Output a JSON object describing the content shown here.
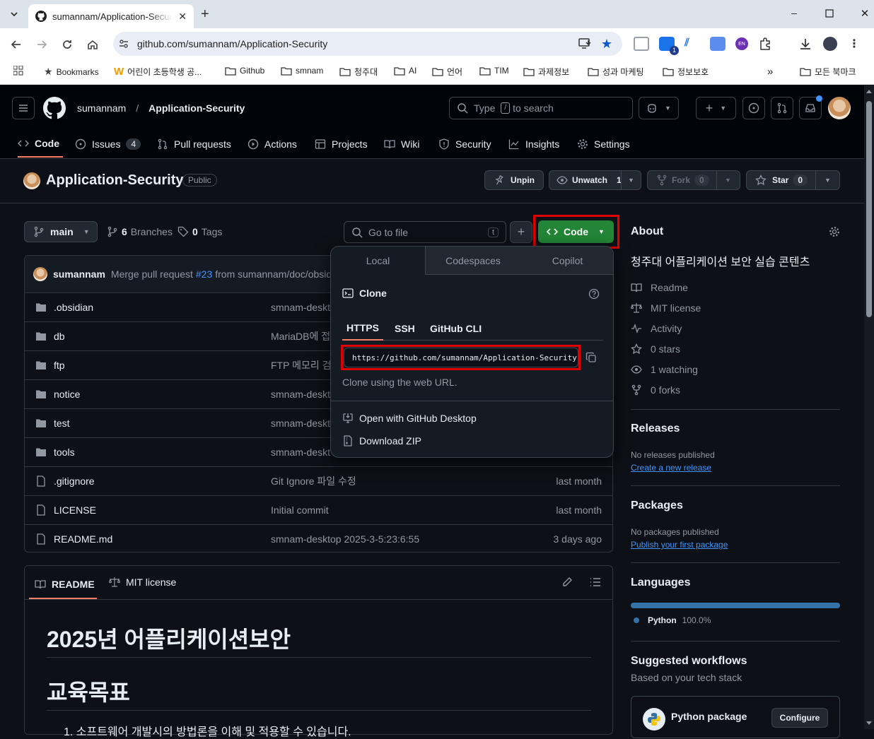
{
  "browser": {
    "tab_title": "sumannam/Application-Security",
    "url": "github.com/sumannam/Application-Security",
    "ext_badge": "1",
    "ext_en": "EN",
    "bookmarks": [
      {
        "label": "Bookmarks",
        "icon": "star-icon"
      },
      {
        "label": "어린이 초등학생 공...",
        "icon": "w-logo-icon"
      },
      {
        "label": "Github",
        "icon": "folder-icon"
      },
      {
        "label": "smnam",
        "icon": "folder-icon"
      },
      {
        "label": "청주대",
        "icon": "folder-icon"
      },
      {
        "label": "AI",
        "icon": "folder-icon"
      },
      {
        "label": "언어",
        "icon": "folder-icon"
      },
      {
        "label": "TIM",
        "icon": "folder-icon"
      },
      {
        "label": "과제정보",
        "icon": "folder-icon"
      },
      {
        "label": "성과 마케팅",
        "icon": "folder-icon"
      },
      {
        "label": "정보보호",
        "icon": "folder-icon"
      }
    ],
    "all_bookmarks": "모든 북마크",
    "overflow": "»"
  },
  "header": {
    "owner": "sumannam",
    "sep": "/",
    "repo": "Application-Security",
    "search_type": "Type",
    "search_key": "/",
    "search_rest": "to search"
  },
  "nav": {
    "code": "Code",
    "issues": "Issues",
    "issues_count": "4",
    "pulls": "Pull requests",
    "actions": "Actions",
    "projects": "Projects",
    "wiki": "Wiki",
    "security": "Security",
    "insights": "Insights",
    "settings": "Settings"
  },
  "repo": {
    "name": "Application-Security",
    "visibility": "Public",
    "unpin": "Unpin",
    "unwatch": "Unwatch",
    "watch_count": "1",
    "fork": "Fork",
    "fork_count": "0",
    "star": "Star",
    "star_count": "0"
  },
  "toolbar": {
    "branch": "main",
    "branches_count": "6",
    "branches_label": "Branches",
    "tags_count": "0",
    "tags_label": "Tags",
    "goto_placeholder": "Go to file",
    "goto_key": "t",
    "code_button": "Code"
  },
  "commit": {
    "author": "sumannam",
    "message": "Merge pull request",
    "pr": "#23",
    "rest": "from sumannam/doc/obsid"
  },
  "files": [
    {
      "type": "dir",
      "name": ".obsidian",
      "msg": "smnam-deskt",
      "date": ""
    },
    {
      "type": "dir",
      "name": "db",
      "msg": "MariaDB에 접",
      "date": ""
    },
    {
      "type": "dir",
      "name": "ftp",
      "msg": "FTP 메모리 검",
      "date": ""
    },
    {
      "type": "dir",
      "name": "notice",
      "msg": "smnam-deskt",
      "date": ""
    },
    {
      "type": "dir",
      "name": "test",
      "msg": "smnam-deskt",
      "date": ""
    },
    {
      "type": "dir",
      "name": "tools",
      "msg": "smnam-deskt",
      "date": ""
    },
    {
      "type": "file",
      "name": ".gitignore",
      "msg": "Git Ignore 파일 수정",
      "date": "last month"
    },
    {
      "type": "file",
      "name": "LICENSE",
      "msg": "Initial commit",
      "date": "last month"
    },
    {
      "type": "file",
      "name": "README.md",
      "msg": "smnam-desktop 2025-3-5:23:6:55",
      "date": "3 days ago"
    }
  ],
  "readme": {
    "tab_readme": "README",
    "tab_license": "MIT license",
    "h1": "2025년 어플리케이션보안",
    "h2": "교육목표",
    "li": "1. 소프트웨어 개발시의 방법론을 이해 및 적용할 수 있습니다."
  },
  "dropdown": {
    "tab_local": "Local",
    "tab_codespaces": "Codespaces",
    "tab_copilot": "Copilot",
    "clone": "Clone",
    "sub_https": "HTTPS",
    "sub_ssh": "SSH",
    "sub_cli": "GitHub CLI",
    "clone_url": "https://github.com/sumannam/Application-Security.git",
    "hint": "Clone using the web URL.",
    "open_desktop": "Open with GitHub Desktop",
    "download_zip": "Download ZIP"
  },
  "about": {
    "title": "About",
    "description": "청주대 어플리케이션 보안 실습 콘텐츠",
    "readme": "Readme",
    "license": "MIT license",
    "activity": "Activity",
    "stars": "0 stars",
    "watching": "1 watching",
    "forks": "0 forks"
  },
  "releases": {
    "title": "Releases",
    "none": "No releases published",
    "create": "Create a new release"
  },
  "packages": {
    "title": "Packages",
    "none": "No packages published",
    "publish": "Publish your first package"
  },
  "languages": {
    "title": "Languages",
    "name": "Python",
    "pct": "100.0%",
    "fraction": 1.0,
    "color": "#3572A5"
  },
  "workflows": {
    "title": "Suggested workflows",
    "sub": "Based on your tech stack",
    "item": "Python package",
    "configure": "Configure"
  },
  "colors": {
    "accent_green": "#238636",
    "link": "#4493f8",
    "highlight": "#e00000"
  }
}
